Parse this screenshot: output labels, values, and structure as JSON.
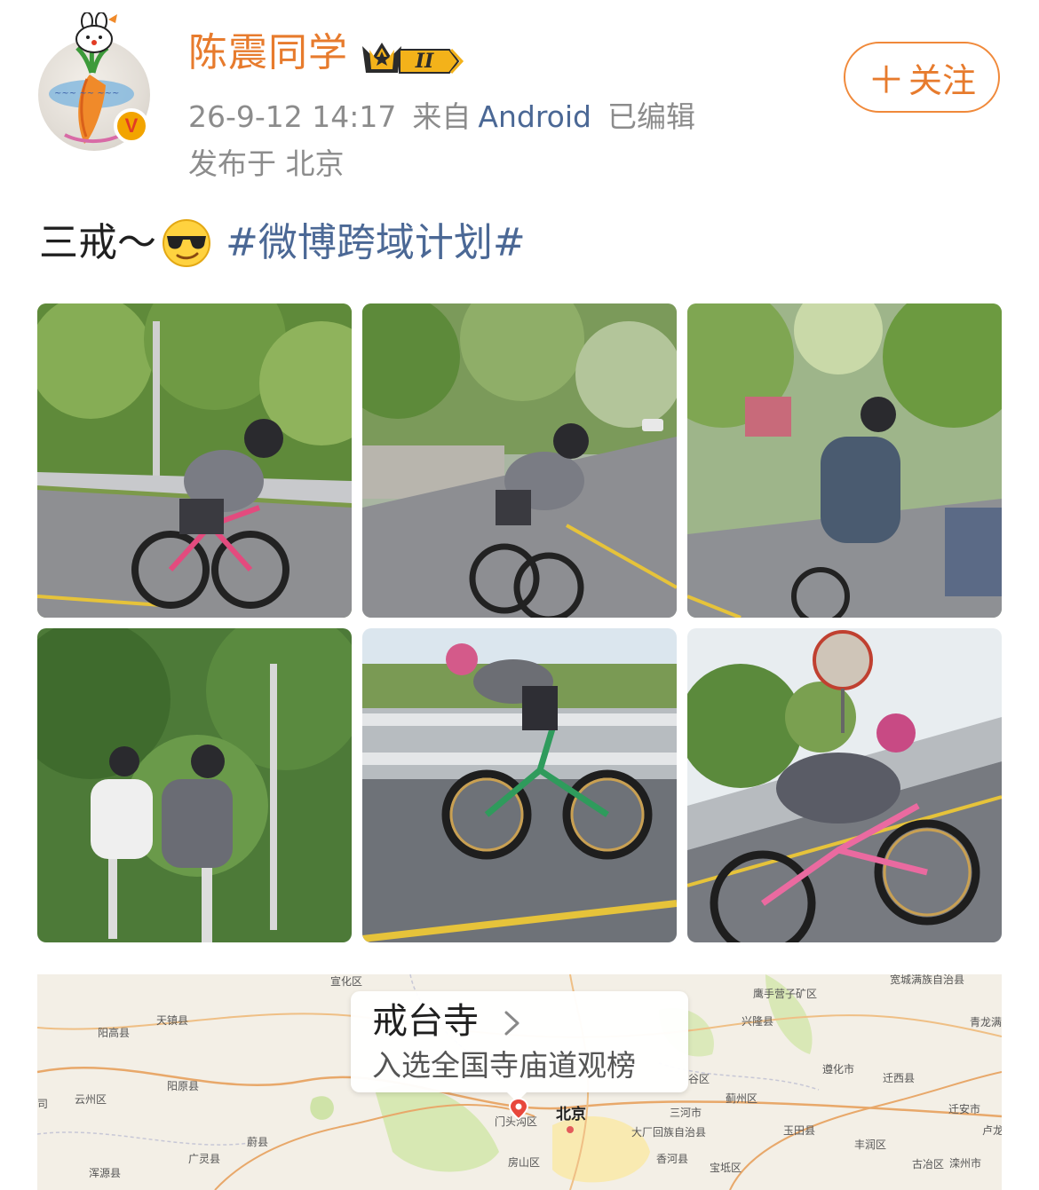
{
  "user": {
    "name": "陈震同学",
    "level_badge": "II",
    "verified_mark": "V",
    "follow_label": "关注",
    "follow_plus": "＋"
  },
  "post": {
    "timestamp": "26-9-12 14:17",
    "source_prefix": "来自",
    "device": "Android",
    "edited_label": "已编辑",
    "location_line": "发布于 北京",
    "text": "三戒～",
    "emoji_icon": "sunglasses-smile-icon",
    "hashtag": "#微博跨域计划#"
  },
  "photos": [
    {
      "name": "photo-1"
    },
    {
      "name": "photo-2"
    },
    {
      "name": "photo-3"
    },
    {
      "name": "photo-4"
    },
    {
      "name": "photo-5"
    },
    {
      "name": "photo-6"
    }
  ],
  "map": {
    "poi_title": "戒台寺",
    "poi_subtitle": "入选全国寺庙道观榜",
    "labels": {
      "xuanhua": "宣化区",
      "kuancheng": "宽城满族自治县",
      "yingshouyingzi": "鹰手营子矿区",
      "tianzhen": "天镇县",
      "yanggao": "阳高县",
      "xinglong": "兴隆县",
      "qinglong": "青龙满",
      "yangyuan": "阳原县",
      "yunzhou": "云州区",
      "zunhua": "遵化市",
      "qianxi": "迁西县",
      "qiananshi": "迁安市",
      "mentougou": "门头沟区",
      "beijing": "北京",
      "sanhe": "三河市",
      "jizhou": "蓟州区",
      "dachang": "大厂回族自治县",
      "yutian": "玉田县",
      "weixian": "蔚县",
      "fangshan": "房山区",
      "xianghe": "香河县",
      "guangling": "广灵县",
      "baodi": "宝坻区",
      "fengrun": "丰润区",
      "guye": "古冶区",
      "luanzhou": "滦州市",
      "hunyuan": "浑源县",
      "lu": "卢龙",
      "si": "司",
      "gu": "谷区"
    }
  },
  "colors": {
    "username": "#e77b2d",
    "link": "#4b6895",
    "meta": "#8c8c8c",
    "follow_border": "#f0893a"
  }
}
